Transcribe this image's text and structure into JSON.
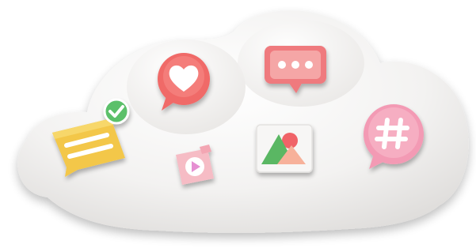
{
  "illustration": {
    "cloud": {
      "color": "#f2f1f0",
      "shade": "#dcdad8"
    },
    "icons": [
      {
        "name": "chat-with-check-icon",
        "color": "#f3c74a",
        "badge_color": "#5cc06b"
      },
      {
        "name": "heart-bubble-icon",
        "color": "#f06a68"
      },
      {
        "name": "dots-message-icon",
        "color": "#ef7a7e"
      },
      {
        "name": "video-play-icon",
        "color": "#f6bcc5"
      },
      {
        "name": "image-picture-icon",
        "colors": [
          "#5ab764",
          "#f06468",
          "#f7b19a"
        ]
      },
      {
        "name": "hashtag-bubble-icon",
        "color": "#f39ab4"
      }
    ]
  }
}
